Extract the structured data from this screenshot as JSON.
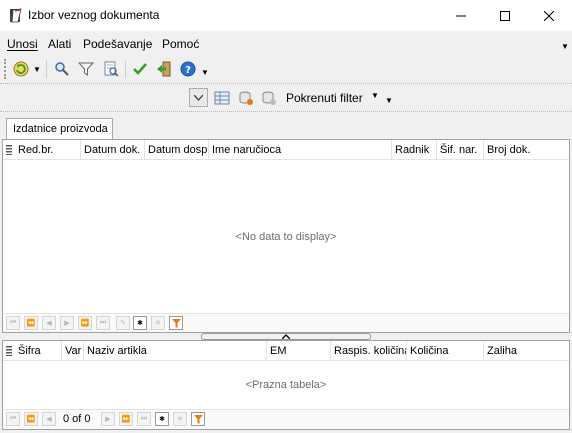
{
  "window": {
    "title": "Izbor veznog dokumenta"
  },
  "menu": {
    "items": [
      "Unosi",
      "Alati",
      "Podešavanje",
      "Pomoć"
    ]
  },
  "toolbar": {
    "filter_label": "Pokrenuti filter"
  },
  "tabs": [
    {
      "label": "Izdatnice proizvoda"
    }
  ],
  "grid_documents": {
    "columns": [
      "Red.br.",
      "Datum dok.",
      "Datum dosp",
      "Ime naručioca",
      "Radnik",
      "Šif. nar.",
      "Broj dok."
    ],
    "empty_text": "<No data to display>"
  },
  "grid_items": {
    "columns": [
      "Šifra",
      "Var",
      "Naziv artikla",
      "EM",
      "Raspis. količina",
      "Količina",
      "Zaliha"
    ],
    "empty_text": "<Prazna tabela>",
    "record_position": "0 of 0"
  },
  "colors": {
    "accent_green": "#3a9a2a",
    "help_blue": "#2a6fd1",
    "filter_orange": "#e07a1a"
  },
  "icons": [
    "app-icon",
    "minimize-icon",
    "maximize-icon",
    "close-icon",
    "refresh-icon",
    "search-icon",
    "filter-icon",
    "preview-icon",
    "check-icon",
    "exit-icon",
    "help-icon"
  ]
}
